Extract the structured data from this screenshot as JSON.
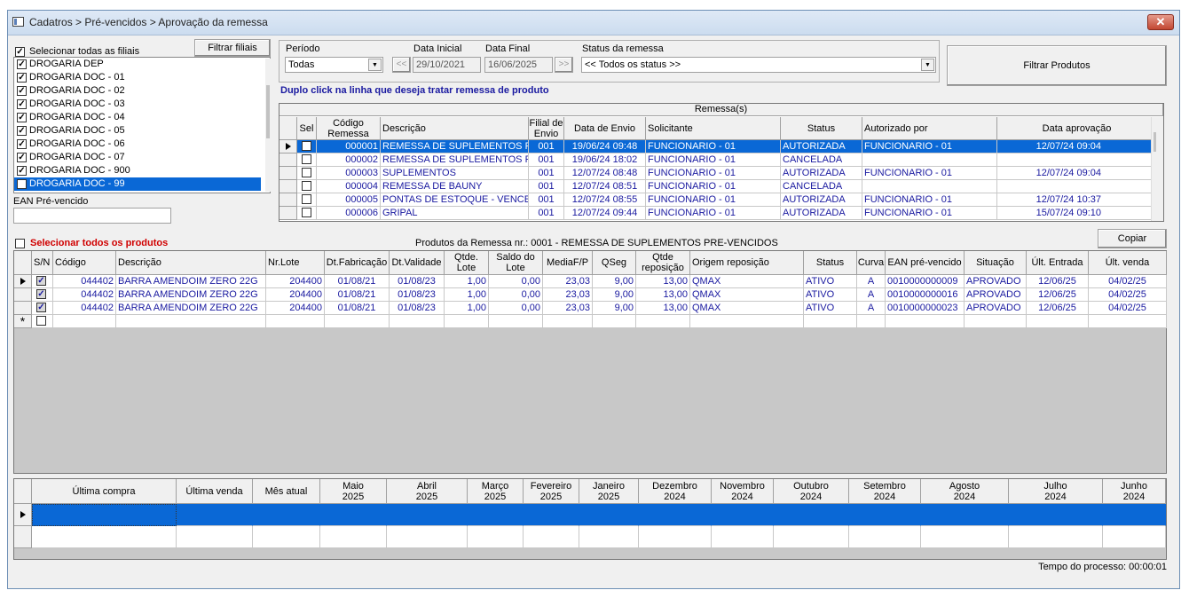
{
  "window": {
    "title": "Cadatros > Pré-vencidos > Aprovação da remessa",
    "close": "✕"
  },
  "filiais": {
    "select_all": "Selecionar todas as filiais",
    "filter_btn": "Filtrar filiais",
    "items": [
      "DROGARIA DEP",
      "DROGARIA DOC - 01",
      "DROGARIA DOC - 02",
      "DROGARIA DOC - 03",
      "DROGARIA DOC - 04",
      "DROGARIA DOC - 05",
      "DROGARIA DOC - 06",
      "DROGARIA DOC - 07",
      "DROGARIA DOC - 900",
      "DROGARIA DOC - 99"
    ]
  },
  "ean": {
    "label": "EAN Pré-vencido",
    "value": ""
  },
  "filters": {
    "periodo_label": "Período",
    "periodo_value": "Todas",
    "data_inicial_label": "Data Inicial",
    "data_inicial": "29/10/2021",
    "data_final_label": "Data Final",
    "data_final": "16/06/2025",
    "prev": "<<",
    "next": ">>",
    "status_label": "Status da remessa",
    "status_value": "<< Todos os status >>",
    "filtrar_btn": "Filtrar Produtos"
  },
  "hint": "Duplo click na linha que deseja tratar remessa de produto",
  "remessas": {
    "caption": "Remessa(s)",
    "headers": [
      "Sel",
      "Código Remessa",
      "Descrição",
      "Filial de Envio",
      "Data de Envio",
      "Solicitante",
      "Status",
      "Autorizado por",
      "Data aprovação"
    ],
    "rows": [
      [
        "000001",
        "REMESSA DE SUPLEMENTOS P",
        "001",
        "19/06/24 09:48",
        "FUNCIONARIO - 01",
        "AUTORIZADA",
        "FUNCIONARIO - 01",
        "12/07/24 09:04"
      ],
      [
        "000002",
        "REMESSA DE SUPLEMENTOS P",
        "001",
        "19/06/24 18:02",
        "FUNCIONARIO - 01",
        "CANCELADA",
        "",
        ""
      ],
      [
        "000003",
        "SUPLEMENTOS",
        "001",
        "12/07/24 08:48",
        "FUNCIONARIO - 01",
        "AUTORIZADA",
        "FUNCIONARIO - 01",
        "12/07/24 09:04"
      ],
      [
        "000004",
        "REMESSA DE BAUNY",
        "001",
        "12/07/24 08:51",
        "FUNCIONARIO - 01",
        "CANCELADA",
        "",
        ""
      ],
      [
        "000005",
        "PONTAS DE ESTOQUE - VENCE",
        "001",
        "12/07/24 08:55",
        "FUNCIONARIO - 01",
        "AUTORIZADA",
        "FUNCIONARIO - 01",
        "12/07/24 10:37"
      ],
      [
        "000006",
        "GRIPAL",
        "001",
        "12/07/24 09:44",
        "FUNCIONARIO - 01",
        "AUTORIZADA",
        "FUNCIONARIO - 01",
        "15/07/24 09:10"
      ]
    ]
  },
  "produtos": {
    "select_all": "Selecionar todos os produtos",
    "caption": "Produtos da Remessa nr.: 0001 - REMESSA DE SUPLEMENTOS PRE-VENCIDOS",
    "copy_btn": "Copiar",
    "headers": [
      "S/N",
      "Código",
      "Descrição",
      "Nr.Lote",
      "Dt.Fabricação",
      "Dt.Validade",
      "Qtde. Lote",
      "Saldo do Lote",
      "MediaF/P",
      "QSeg",
      "Qtde reposição",
      "Origem reposição",
      "Status",
      "Curva",
      "EAN pré-vencido",
      "Situação",
      "Últ. Entrada",
      "Últ. venda"
    ],
    "rows": [
      [
        "044402",
        "BARRA AMENDOIM ZERO 22G",
        "204400",
        "01/08/21",
        "01/08/23",
        "1,00",
        "0,00",
        "23,03",
        "9,00",
        "13,00",
        "QMAX",
        "ATIVO",
        "A",
        "0010000000009",
        "APROVADO",
        "12/06/25",
        "04/02/25"
      ],
      [
        "044402",
        "BARRA AMENDOIM ZERO 22G",
        "204400",
        "01/08/21",
        "01/08/23",
        "1,00",
        "0,00",
        "23,03",
        "9,00",
        "13,00",
        "QMAX",
        "ATIVO",
        "A",
        "0010000000016",
        "APROVADO",
        "12/06/25",
        "04/02/25"
      ],
      [
        "044402",
        "BARRA AMENDOIM ZERO 22G",
        "204400",
        "01/08/21",
        "01/08/23",
        "1,00",
        "0,00",
        "23,03",
        "9,00",
        "13,00",
        "QMAX",
        "ATIVO",
        "A",
        "0010000000023",
        "APROVADO",
        "12/06/25",
        "04/02/25"
      ]
    ],
    "new_row": "*"
  },
  "historico": {
    "headers": [
      [
        "Última compra",
        ""
      ],
      [
        "Última venda",
        ""
      ],
      [
        "Mês atual",
        ""
      ],
      [
        "Maio",
        "2025"
      ],
      [
        "Abril",
        "2025"
      ],
      [
        "Março",
        "2025"
      ],
      [
        "Fevereiro",
        "2025"
      ],
      [
        "Janeiro",
        "2025"
      ],
      [
        "Dezembro",
        "2024"
      ],
      [
        "Novembro",
        "2024"
      ],
      [
        "Outubro",
        "2024"
      ],
      [
        "Setembro",
        "2024"
      ],
      [
        "Agosto",
        "2024"
      ],
      [
        "Julho",
        "2024"
      ],
      [
        "Junho",
        "2024"
      ]
    ]
  },
  "status_bar": "Tempo do processo: 00:00:01"
}
